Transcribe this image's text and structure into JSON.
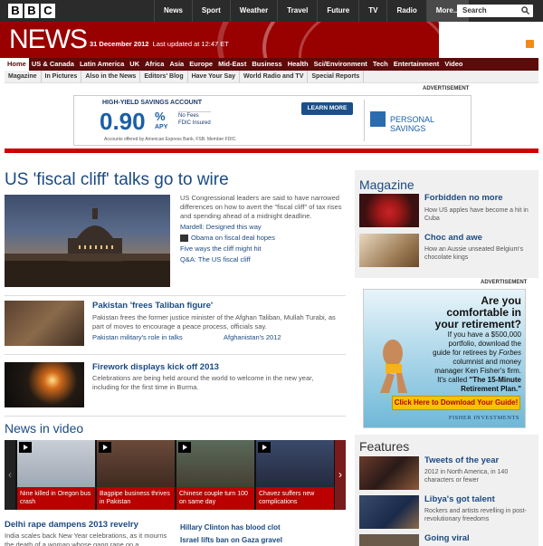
{
  "topbar": {
    "logo_letters": [
      "B",
      "B",
      "C"
    ],
    "nav": [
      "News",
      "Sport",
      "Weather",
      "Travel",
      "Future",
      "TV",
      "Radio",
      "More..."
    ],
    "search_placeholder": "Search"
  },
  "masthead": {
    "title": "NEWS",
    "date": "31 December 2012",
    "updated": "Last updated at 12:47 ET"
  },
  "main_nav": [
    "Home",
    "US & Canada",
    "Latin America",
    "UK",
    "Africa",
    "Asia",
    "Europe",
    "Mid-East",
    "Business",
    "Health",
    "Sci/Environment",
    "Tech",
    "Entertainment",
    "Video"
  ],
  "sub_nav": [
    "Magazine",
    "In Pictures",
    "Also in the News",
    "Editors' Blog",
    "Have Your Say",
    "World Radio and TV",
    "Special Reports"
  ],
  "top_ad": {
    "label": "ADVERTISEMENT",
    "heading": "HIGH-YIELD SAVINGS ACCOUNT",
    "rate": "0.90",
    "percent": "%",
    "apy": "APY",
    "fees": "No Fees",
    "fdic": "FDIC Insured",
    "fine": "Accounts offered by American Express Bank, FSB. Member FDIC.",
    "cta": "LEARN MORE",
    "brand": "PERSONAL SAVINGS"
  },
  "lead": {
    "headline": "US 'fiscal cliff' talks go to wire",
    "summary": "US Congressional leaders are said to have narrowed differences on how to avert the \"fiscal cliff\" of tax rises and spending ahead of a midnight deadline.",
    "links": [
      "Mardell: Designed this way",
      "Obama on fiscal deal hopes",
      "Five ways the cliff might hit",
      "Q&A: The US fiscal cliff"
    ]
  },
  "stories": [
    {
      "title": "Pakistan 'frees Taliban figure'",
      "text": "Pakistan frees the former justice minister of the Afghan Taliban, Mullah Turabi, as part of moves to encourage a peace process, officials say.",
      "links": [
        "Pakistan military's role in talks",
        "Afghanistan's 2012"
      ]
    },
    {
      "title": "Firework displays kick off 2013",
      "text": "Celebrations are being held around the world to welcome in the new year, including for the first time in Burma."
    }
  ],
  "news_in_video": {
    "title": "News in video",
    "items": [
      "Nine killed in Oregon bus crash",
      "Bagpipe business thrives in Pakistan",
      "Chinese couple turn 100 on same day",
      "Chavez suffers new complications"
    ]
  },
  "bottom_stories": [
    {
      "title": "Delhi rape dampens 2013 revelry",
      "text": "India scales back New Year celebrations, as it mourns the death of a woman whose gang rape on a"
    },
    {
      "title": "Hillary Clinton has blood clot"
    },
    {
      "title": "Israel lifts ban on Gaza gravel"
    }
  ],
  "magazine": {
    "title": "Magazine",
    "items": [
      {
        "title": "Forbidden no more",
        "text": "How US apples have become a hit in Cuba"
      },
      {
        "title": "Choc and awe",
        "text": "How an Aussie unseated Belgium's chocolate kings"
      }
    ]
  },
  "right_ad": {
    "label": "ADVERTISEMENT",
    "question": "Are you comfortable in your retirement?",
    "body_pre": "If you have a $500,000 portfolio, download the guide for retirees by",
    "forbes": "Forbes",
    "body_post": "columnist and money manager Ken Fisher's firm. It's called",
    "guide": "\"The 15-Minute Retirement Plan.\"",
    "cta": "Click Here to Download Your Guide!",
    "brand": "FISHER INVESTMENTS"
  },
  "features": {
    "title": "Features",
    "items": [
      {
        "title": "Tweets of the year",
        "text": "2012 in North America, in 140 characters or fewer"
      },
      {
        "title": "Libya's got talent",
        "text": "Rockers and artists revelling in post-revolutionary freedoms"
      },
      {
        "title": "Going viral"
      }
    ]
  }
}
